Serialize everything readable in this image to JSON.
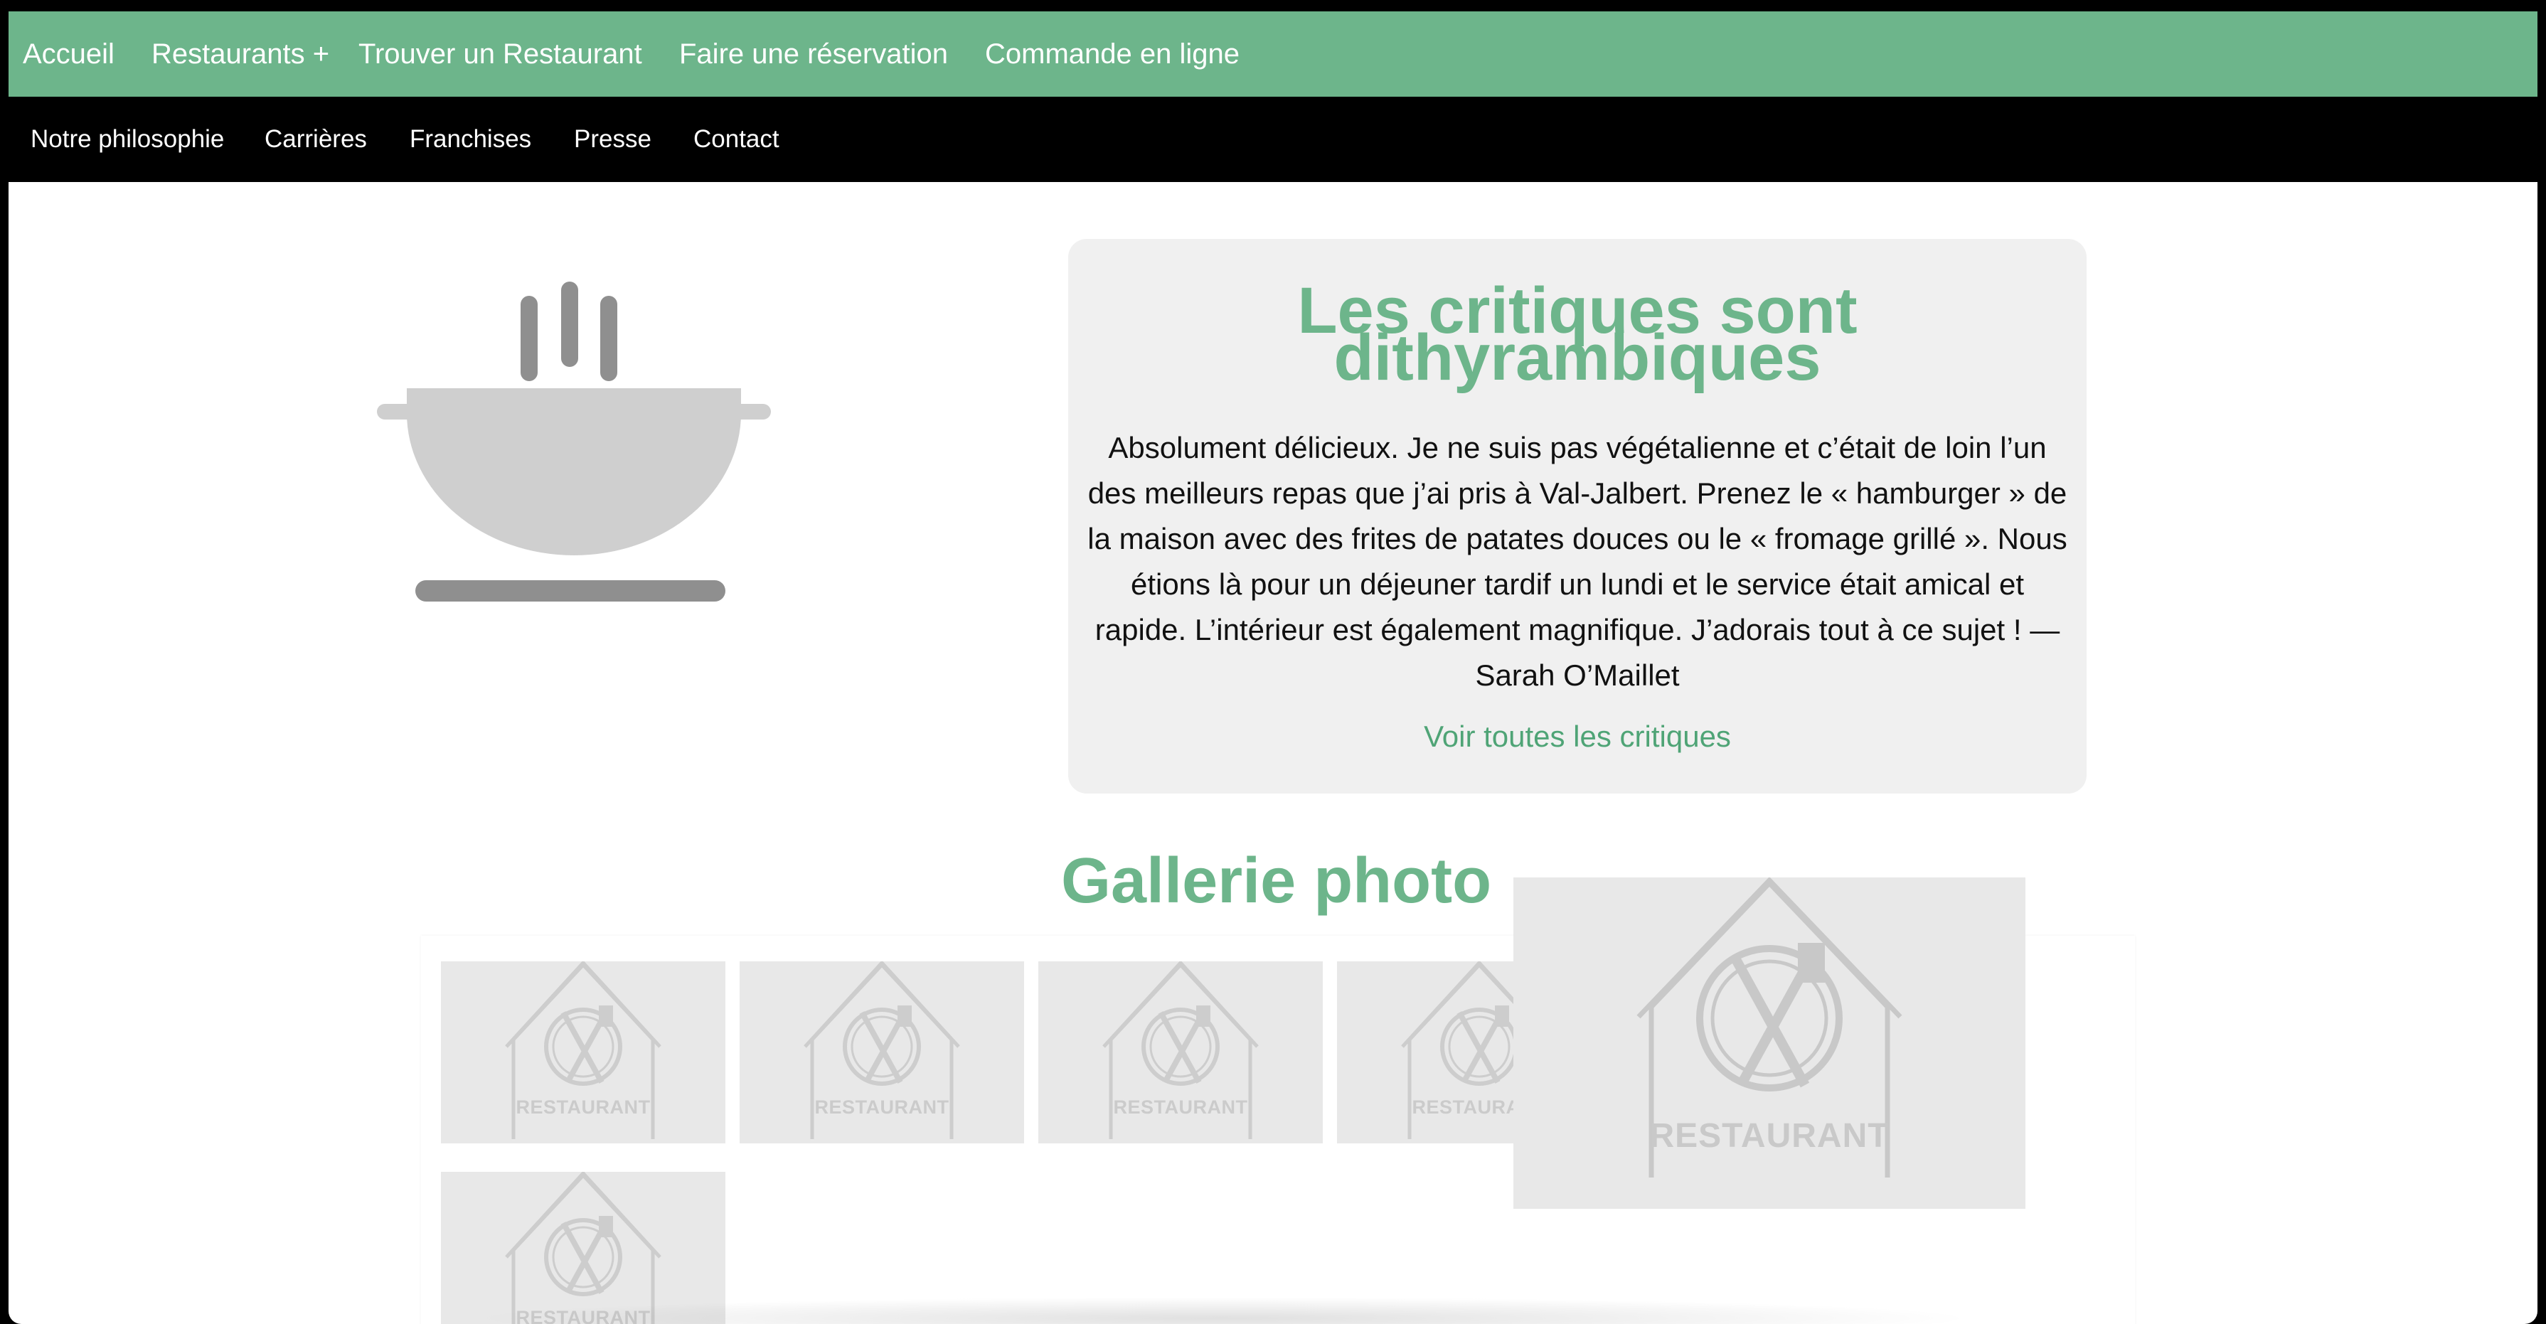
{
  "nav_primary": {
    "items": [
      "Accueil",
      "Restaurants +",
      "Trouver un Restaurant",
      "Faire une réservation",
      "Commande en ligne"
    ],
    "color": "#6db58b"
  },
  "nav_secondary": {
    "items": [
      "Notre philosophie",
      "Carrières",
      "Franchises",
      "Presse",
      "Contact"
    ],
    "color": "#000000"
  },
  "hero": {
    "icon": "cooking-pot-icon"
  },
  "review": {
    "title_line1": "Les critiques sont",
    "title_line2": "dithyrambiques",
    "body": "Absolument délicieux. Je ne suis pas végétalienne et c’était de loin l’un des meilleurs repas que j’ai pris à Val-Jalbert. Prenez le « hamburger » de la maison avec des frites de patates douces ou le « fromage grillé ». Nous étions là pour un déjeuner tardif un lundi et le service était amical et rapide. L’intérieur est également magnifique. J’adorais tout à ce sujet ! — Sarah O’Maillet",
    "link": "Voir toutes les critiques"
  },
  "gallery": {
    "title": "Gallerie photo",
    "thumb_label": "RESTAURANT",
    "thumb_count": 5,
    "lightbox_label": "RESTAURANT"
  },
  "colors": {
    "accent": "#6db58b",
    "link": "#4fa476",
    "card": "#f0f0f0",
    "placeholder": "#e8e8e8"
  }
}
